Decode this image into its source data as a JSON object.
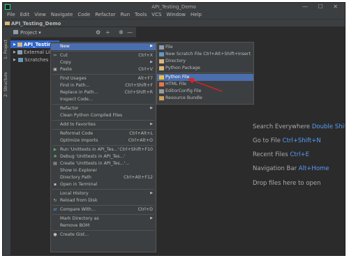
{
  "window": {
    "title": "API_Testing_Demo",
    "controls": "— ☐ ✕"
  },
  "menubar": [
    "File",
    "Edit",
    "View",
    "Navigate",
    "Code",
    "Refactor",
    "Run",
    "Tools",
    "VCS",
    "Window",
    "Help"
  ],
  "breadcrumb": "API_Testing_Demo",
  "tool_strip": {
    "project_tab": "1: Project",
    "structure_tab": "2: Structure"
  },
  "project_panel": {
    "header": "Project",
    "header_dropdown": "▾",
    "header_icons": [
      "⚙",
      "÷",
      "✲",
      "—"
    ]
  },
  "tree": [
    {
      "label": "API_Testing_D",
      "selected": true,
      "expanded": false,
      "icon": "folder-icon"
    },
    {
      "label": "External Librar",
      "selected": false,
      "expanded": false,
      "icon": "library-icon"
    },
    {
      "label": "Scratches and",
      "selected": false,
      "expanded": false,
      "icon": "scratches-icon"
    }
  ],
  "editor_hints": [
    {
      "text": "Search Everywhere",
      "key": "Double Shift"
    },
    {
      "text": "Go to File",
      "key": "Ctrl+Shift+N"
    },
    {
      "text": "Recent Files",
      "key": "Ctrl+E"
    },
    {
      "text": "Navigation Bar",
      "key": "Alt+Home"
    },
    {
      "text": "Drop files here to open",
      "key": ""
    }
  ],
  "context_menu": [
    {
      "label": "New",
      "shortcut": "",
      "submenu": true,
      "active": true,
      "icon": ""
    },
    {
      "sep": true
    },
    {
      "label": "Cut",
      "shortcut": "Ctrl+X",
      "icon": "cut-icon"
    },
    {
      "label": "Copy",
      "shortcut": "",
      "submenu": true,
      "icon": ""
    },
    {
      "label": "Paste",
      "shortcut": "Ctrl+V",
      "icon": "paste-icon"
    },
    {
      "sep": true
    },
    {
      "label": "Find Usages",
      "shortcut": "Alt+F7"
    },
    {
      "label": "Find in Path...",
      "shortcut": "Ctrl+Shift+F"
    },
    {
      "label": "Replace in Path...",
      "shortcut": "Ctrl+Shift+R"
    },
    {
      "label": "Inspect Code..."
    },
    {
      "sep": true
    },
    {
      "label": "Refactor",
      "submenu": true
    },
    {
      "label": "Clean Python Compiled Files"
    },
    {
      "sep": true
    },
    {
      "label": "Add to Favorites",
      "submenu": true
    },
    {
      "sep": true
    },
    {
      "label": "Reformat Code",
      "shortcut": "Ctrl+Alt+L"
    },
    {
      "label": "Optimize Imports",
      "shortcut": "Ctrl+Alt+O"
    },
    {
      "sep": true
    },
    {
      "label": "Run 'Unittests in API_Tes...'",
      "shortcut": "Ctrl+Shift+F10",
      "icon": "run-icon"
    },
    {
      "label": "Debug 'Unittests in API_Tes...'",
      "icon": "debug-icon"
    },
    {
      "label": "Create 'Unittests in API_Tes...'...",
      "icon": "create-config-icon"
    },
    {
      "label": "Show in Explorer"
    },
    {
      "label": "Directory Path",
      "shortcut": "Ctrl+Alt+F12"
    },
    {
      "label": "Open in Terminal",
      "icon": "terminal-icon"
    },
    {
      "sep": true
    },
    {
      "label": "Local History",
      "submenu": true
    },
    {
      "label": "Reload from Disk",
      "icon": "reload-icon"
    },
    {
      "sep": true
    },
    {
      "label": "Compare With...",
      "shortcut": "Ctrl+D",
      "icon": "compare-icon"
    },
    {
      "sep": true
    },
    {
      "label": "Mark Directory as",
      "submenu": true
    },
    {
      "label": "Remove BOM"
    },
    {
      "sep": true
    },
    {
      "label": "Create Gist...",
      "icon": "github-icon"
    }
  ],
  "submenu": [
    {
      "label": "File",
      "shortcut": "",
      "icon": "file-icon"
    },
    {
      "label": "New Scratch File",
      "shortcut": "Ctrl+Alt+Shift+Insert",
      "icon": "scratch-file-icon"
    },
    {
      "label": "Directory",
      "shortcut": "",
      "icon": "directory-icon"
    },
    {
      "label": "Python Package",
      "shortcut": "",
      "icon": "python-package-icon"
    },
    {
      "sep": true
    },
    {
      "label": "Python File",
      "shortcut": "",
      "icon": "python-file-icon",
      "active": true
    },
    {
      "label": "HTML File",
      "shortcut": "",
      "icon": "html-file-icon"
    },
    {
      "label": "EditorConfig File",
      "shortcut": "",
      "icon": "editorconfig-icon"
    },
    {
      "label": "Resource Bundle",
      "shortcut": "",
      "icon": "resource-bundle-icon"
    }
  ],
  "colors": {
    "menu_bg": "#3c3f41",
    "editor_bg": "#2b2b2b",
    "selection": "#4b6eaf",
    "tree_selection": "#2f65ca",
    "hint_key": "#589df6",
    "annotation_arrow": "#e02020"
  }
}
